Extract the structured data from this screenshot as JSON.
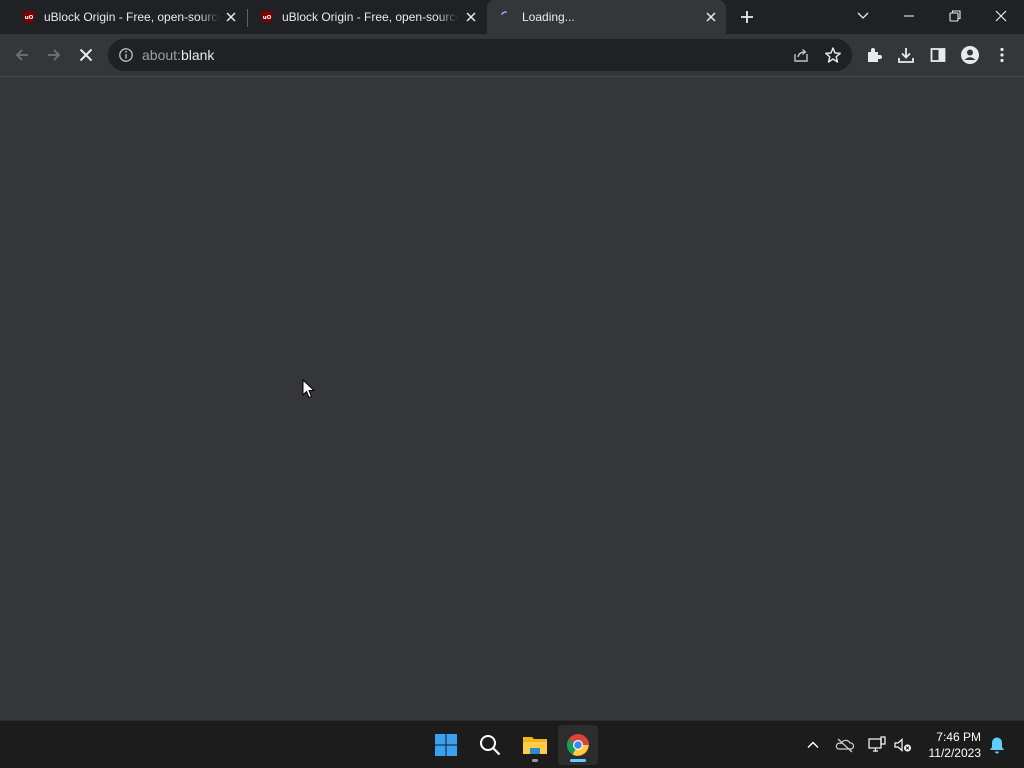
{
  "browser": {
    "tabs": [
      {
        "title": "uBlock Origin - Free, open-source ad content blocker.",
        "favicon": "ublock-origin-icon",
        "active": false
      },
      {
        "title": "uBlock Origin - Free, open-source ad content blocker.",
        "favicon": "ublock-origin-icon",
        "active": false
      },
      {
        "title": "Loading...",
        "favicon": "loading-spinner-icon",
        "active": true
      }
    ],
    "omnibox": {
      "scheme": "about:",
      "path": "blank"
    },
    "toolbar_icons": [
      "back-icon",
      "forward-icon",
      "stop-icon",
      "share-icon",
      "star-icon",
      "extensions-icon",
      "download-icon",
      "side-panel-icon",
      "profile-icon",
      "menu-icon"
    ],
    "theme": {
      "frame": "#202124",
      "toolbar": "#35363a",
      "accent": "#8ab4f8",
      "ublock_red": "#800000"
    }
  },
  "taskbar": {
    "apps": [
      "start-icon",
      "search-icon",
      "file-explorer-icon",
      "chrome-icon"
    ],
    "tray_icons": [
      "chevron-up-icon",
      "onedrive-offline-icon",
      "network-icon",
      "volume-muted-icon",
      "notification-bell-icon"
    ],
    "time": "7:46 PM",
    "date": "11/2/2023"
  }
}
